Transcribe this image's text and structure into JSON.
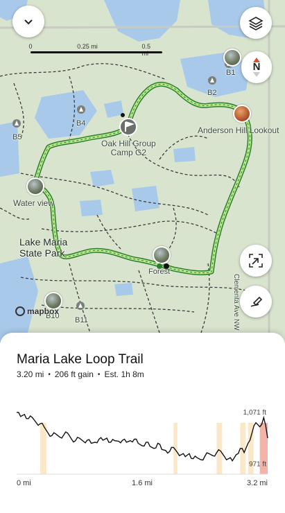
{
  "map": {
    "scale": {
      "ticks": [
        "0",
        "0.25 mi",
        "0.5 mi"
      ]
    },
    "labels": {
      "b1": "B1",
      "b2": "B2",
      "b4": "B4",
      "b5": "B5",
      "b11": "B11",
      "b10": "B10",
      "oak_hill": "Oak Hill Group\nCamp G2",
      "anderson_hill": "Anderson Hill Lookout",
      "water_view": "Water view",
      "park_name": "Lake Maria\nState Park",
      "forest": "Forest",
      "road": "Clementa Ave NW"
    },
    "attribution": "mapbox",
    "compass_letter": "N"
  },
  "trail": {
    "name": "Maria Lake Loop Trail",
    "distance": "3.20 mi",
    "gain": "206 ft gain",
    "est_time": "Est. 1h 8m",
    "separator": "•"
  },
  "chart_data": {
    "type": "area",
    "title": "",
    "xlabel": "",
    "ylabel": "",
    "x_tick_labels": [
      "0 mi",
      "1.6 mi",
      "3.2 mi"
    ],
    "y_tick_labels": [
      "1,071 ft",
      "971 ft"
    ],
    "xlim": [
      0,
      3.2
    ],
    "ylim": [
      950,
      1090
    ],
    "series": [
      {
        "x": [
          0.0,
          0.05,
          0.1,
          0.15,
          0.2,
          0.25,
          0.3,
          0.35,
          0.4,
          0.45,
          0.5,
          0.55,
          0.6,
          0.65,
          0.7,
          0.75,
          0.8,
          0.85,
          0.9,
          0.95,
          1.0,
          1.05,
          1.1,
          1.15,
          1.2,
          1.25,
          1.3,
          1.35,
          1.4,
          1.45,
          1.5,
          1.55,
          1.6,
          1.65,
          1.7,
          1.75,
          1.8,
          1.85,
          1.9,
          1.95,
          2.0,
          2.05,
          2.1,
          2.15,
          2.2,
          2.25,
          2.3,
          2.35,
          2.4,
          2.45,
          2.5,
          2.55,
          2.6,
          2.65,
          2.7,
          2.75,
          2.8,
          2.85,
          2.9,
          2.95,
          3.0,
          3.05,
          3.1,
          3.15,
          3.2
        ],
        "values": [
          1070,
          1062,
          1066,
          1058,
          1060,
          1050,
          1048,
          1042,
          1030,
          1025,
          1028,
          1022,
          1026,
          1030,
          1018,
          1015,
          1020,
          1014,
          1016,
          1010,
          1012,
          1018,
          1016,
          1020,
          1012,
          1015,
          1014,
          1016,
          1012,
          1015,
          1018,
          1010,
          1005,
          1012,
          1004,
          1000,
          1010,
          998,
          996,
          994,
          1002,
          992,
          988,
          984,
          990,
          980,
          982,
          978,
          985,
          990,
          986,
          992,
          995,
          984,
          980,
          976,
          988,
          1000,
          992,
          1010,
          1030,
          1050,
          1042,
          1060,
          1020
        ]
      }
    ]
  }
}
